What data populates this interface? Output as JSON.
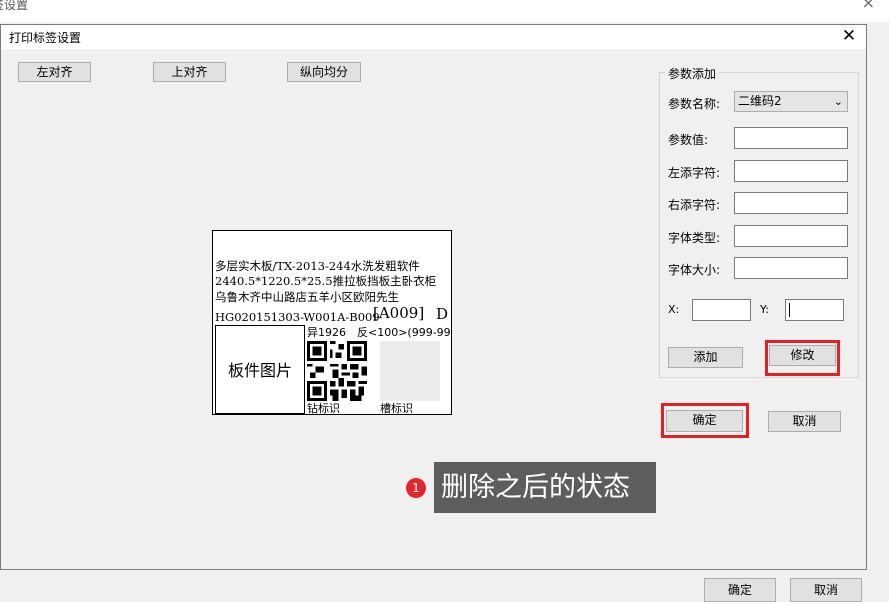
{
  "background_window": {
    "title": "签设置",
    "close_glyph": "×",
    "buttons": [
      "确定",
      "取消"
    ]
  },
  "dialog": {
    "title": "打印标签设置",
    "close_glyph": "✕"
  },
  "toolbar": {
    "align_left": "左对齐",
    "align_top": "上对齐",
    "distribute_vertical": "纵向均分"
  },
  "label_preview": {
    "line1": "多层实木板/TX-2013-244水洗发粗软件",
    "line2": "2440.5*1220.5*25.5推拉板挡板主卧衣柜",
    "line3": "乌鲁木齐中山路店五羊小区欧阳先生",
    "line4": "HG020151303-W001A-B009",
    "code_box": "[A009]",
    "code_suffix": "D",
    "shape_text": "异1926",
    "edge_text": "反<100>(999-99",
    "photo_label": "板件图片",
    "drill_label": "钻标识",
    "groove_label": "槽标识"
  },
  "param_panel": {
    "group_title": "参数添加",
    "param_name_label": "参数名称:",
    "param_name_value": "二维码2",
    "param_value_label": "参数值:",
    "left_char_label": "左添字符:",
    "right_char_label": "右添字符:",
    "font_type_label": "字体类型:",
    "font_size_label": "字体大小:",
    "x_label": "X:",
    "y_label": "Y:",
    "add_button": "添加",
    "modify_button": "修改"
  },
  "actions": {
    "ok_button": "确定",
    "cancel_button": "取消"
  },
  "annotation": {
    "number": "1",
    "text": "删除之后的状态",
    "highlight_color": "#e41f25"
  }
}
